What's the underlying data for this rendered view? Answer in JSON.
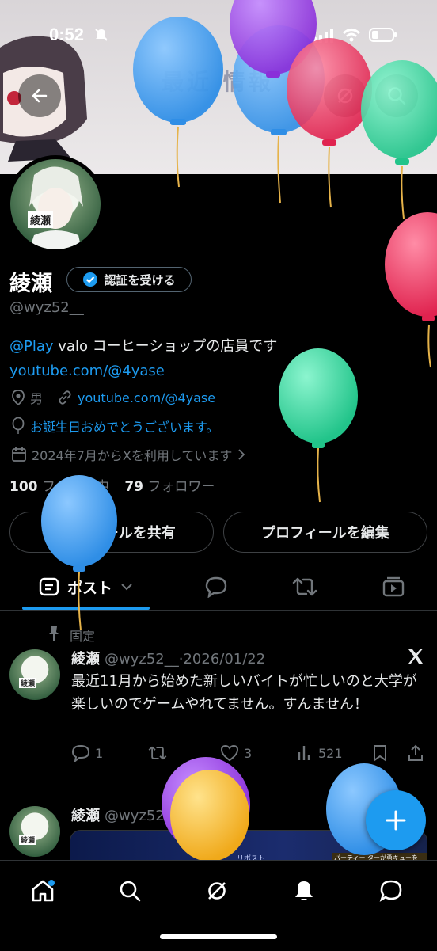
{
  "status": {
    "time": "0:52"
  },
  "banner": {
    "text": "最近 情報"
  },
  "profile": {
    "avatar_label": "綾瀬",
    "name": "綾瀬",
    "verify_label": "認証を受ける",
    "handle": "@wyz52__",
    "bio_link_handle": "@Play",
    "bio_text": " valo コーヒーショップの店員です",
    "bio_url": "youtube.com/@4yase",
    "gender": "男",
    "website": "youtube.com/@4yase",
    "birthday": "お誕生日おめでとうございます。",
    "joined": "2024年7月からXを利用しています",
    "following_count": "100",
    "following_label": "フォロー中",
    "followers_count": "79",
    "followers_label": "フォロワー",
    "share_label": "プロフィールを共有",
    "edit_label": "プロフィールを編集"
  },
  "tabs": {
    "posts_label": "ポスト"
  },
  "pinned": {
    "pinned_label": "固定",
    "author_name": "綾瀬",
    "author_handle": "@wyz52__",
    "date": "·2026/01/22",
    "text": "最近11月から始めた新しいバイトが忙しいのと大学が楽しいのでゲームやれてません。すんません！",
    "replies": "1",
    "likes": "3",
    "views": "521"
  },
  "second_post": {
    "author_name": "綾瀬",
    "author_handle": "@wyz52",
    "media_text_left": "リポスト",
    "media_text_right": "パーティー ターが勇キューを決定"
  },
  "colors": {
    "accent": "#1d9bf0",
    "background": "#000000",
    "muted": "#71767b"
  },
  "icons": [
    "back-arrow-icon",
    "grok-icon",
    "search-icon",
    "verified-badge-icon",
    "location-icon",
    "link-icon",
    "balloon-icon",
    "calendar-icon",
    "posts-icon",
    "replies-icon",
    "retweet-icon",
    "media-icon",
    "pin-icon",
    "x-logo-icon",
    "reply-icon",
    "like-icon",
    "views-icon",
    "bookmark-icon",
    "share-icon",
    "home-icon",
    "explore-icon",
    "grok-nav-icon",
    "notifications-icon",
    "messages-icon",
    "plus-icon"
  ]
}
